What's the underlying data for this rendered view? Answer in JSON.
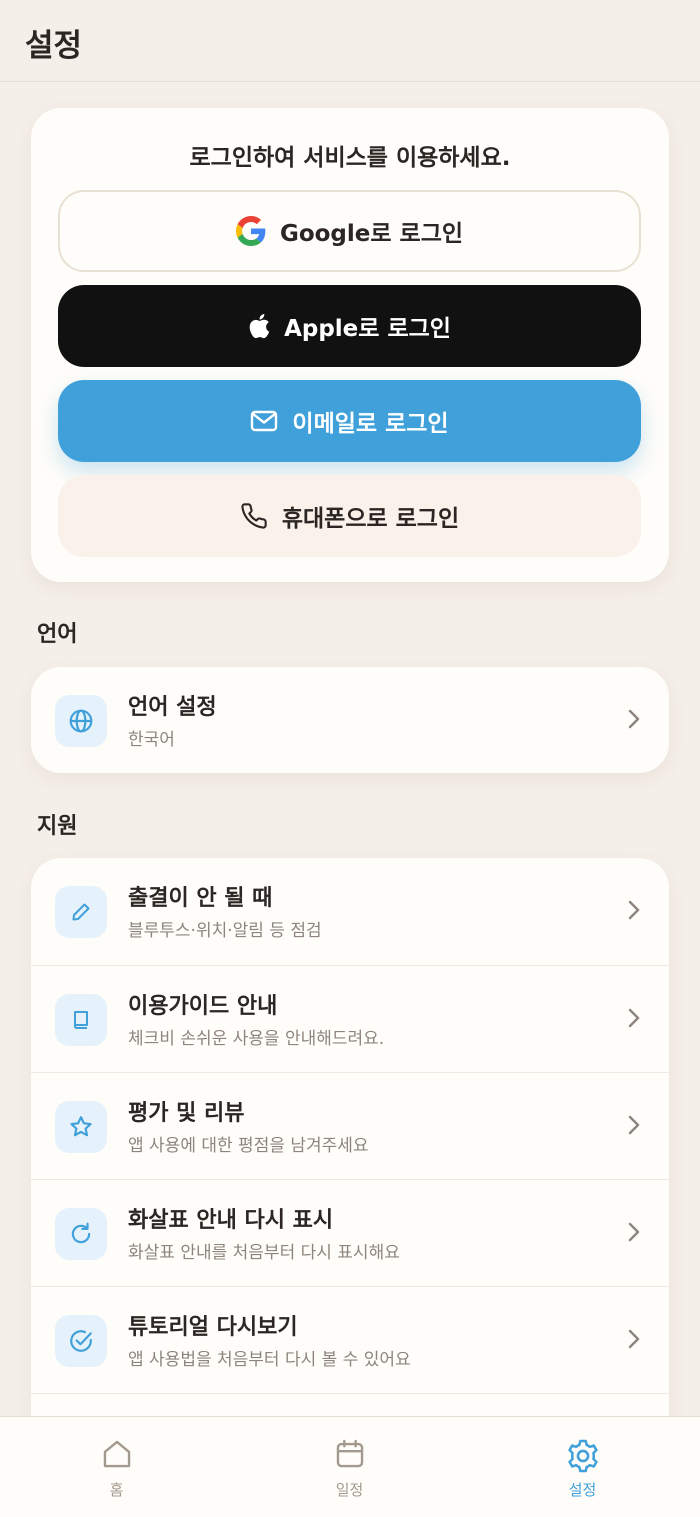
{
  "header": {
    "title": "설정"
  },
  "login": {
    "prompt": "로그인하여 서비스를 이용하세요.",
    "google_label": "Google로 로그인",
    "apple_label": "Apple로 로그인",
    "email_label": "이메일로 로그인",
    "phone_label": "휴대폰으로 로그인"
  },
  "language": {
    "section_label": "언어",
    "item": {
      "title": "언어 설정",
      "subtitle": "한국어",
      "icon": "globe-icon"
    }
  },
  "support": {
    "section_label": "지원",
    "items": [
      {
        "title": "출결이 안 될 때",
        "subtitle": "블루투스·위치·알림 등 점검",
        "icon": "pencil-icon"
      },
      {
        "title": "이용가이드 안내",
        "subtitle": "체크비 손쉬운 사용을 안내해드려요.",
        "icon": "book-icon"
      },
      {
        "title": "평가 및 리뷰",
        "subtitle": "앱 사용에 대한 평점을 남겨주세요",
        "icon": "star-icon"
      },
      {
        "title": "화살표 안내 다시 표시",
        "subtitle": "화살표 안내를 처음부터 다시 표시해요",
        "icon": "refresh-icon"
      },
      {
        "title": "튜토리얼 다시보기",
        "subtitle": "앱 사용법을 처음부터 다시 볼 수 있어요",
        "icon": "check-circle-icon"
      }
    ]
  },
  "tabbar": {
    "tabs": [
      {
        "label": "홈",
        "icon": "home-icon"
      },
      {
        "label": "일정",
        "icon": "calendar-icon"
      },
      {
        "label": "설정",
        "icon": "gear-icon",
        "active": true
      }
    ]
  },
  "colors": {
    "accent": "#3fa0da",
    "background": "#f5efe9",
    "card": "#fffdf9",
    "apple_button": "#111111",
    "phone_button": "#faf2ea"
  }
}
